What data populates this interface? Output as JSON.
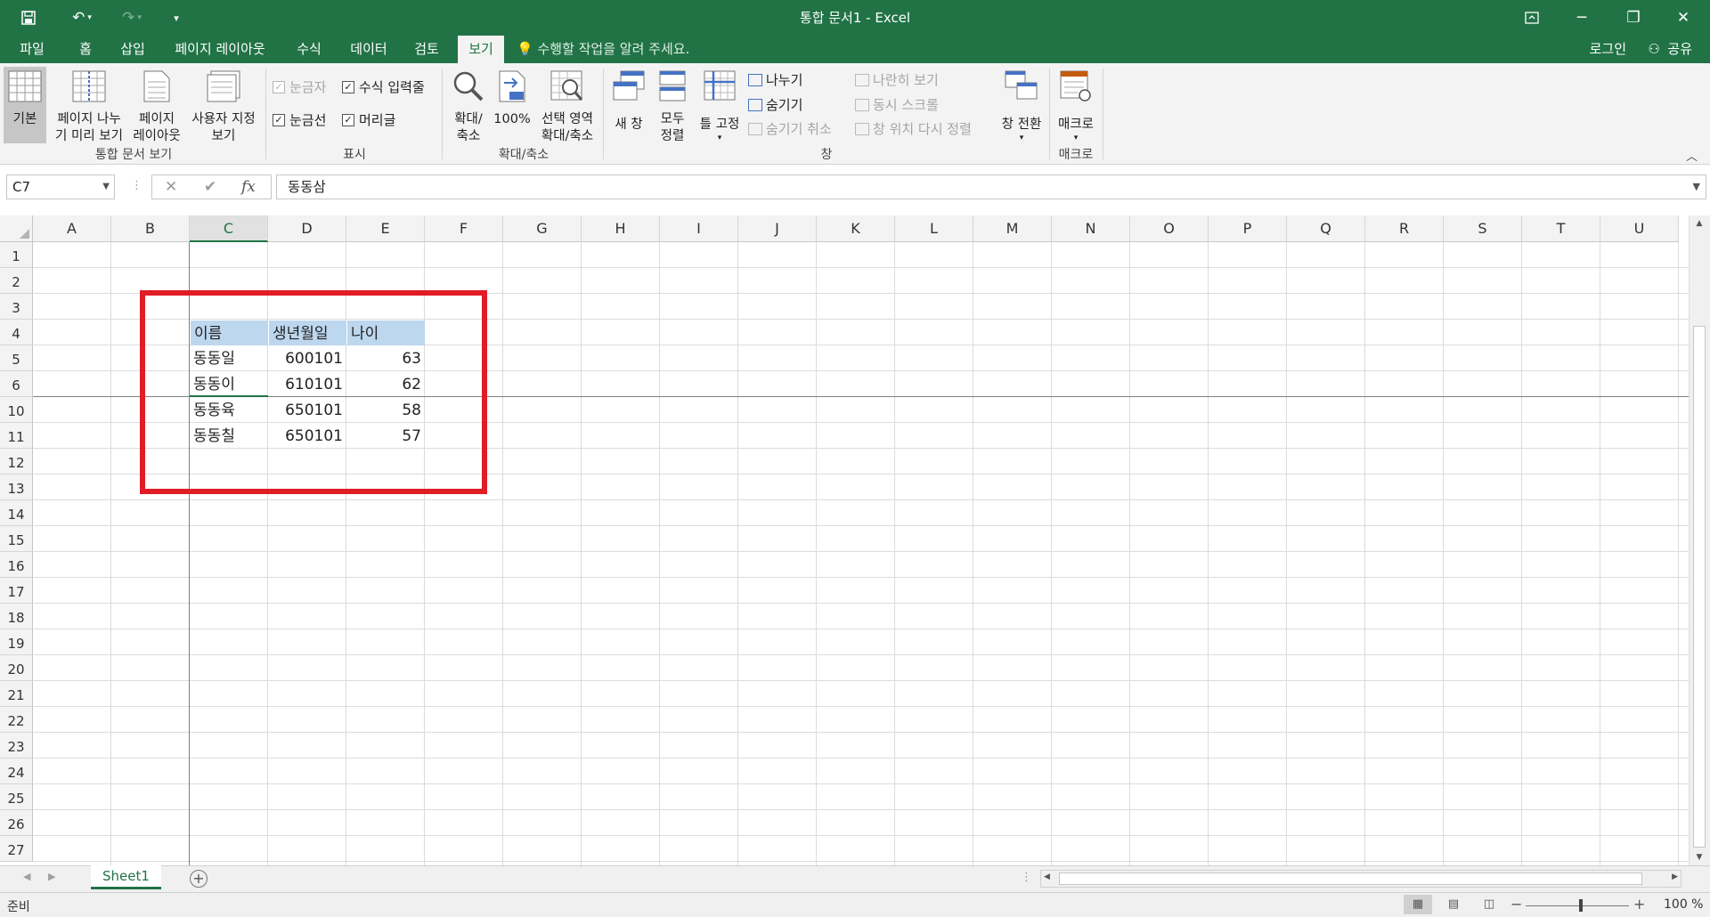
{
  "window": {
    "title": "통합 문서1 - Excel"
  },
  "tabs": [
    "파일",
    "홈",
    "삽입",
    "페이지 레이아웃",
    "수식",
    "데이터",
    "검토",
    "보기"
  ],
  "active_tab": "보기",
  "tell_me": "수행할 작업을 알려 주세요.",
  "account": {
    "login": "로그인",
    "share": "공유"
  },
  "ribbon": {
    "workbook_views": {
      "label": "통합 문서 보기",
      "buttons": [
        {
          "line1": "기본",
          "line2": ""
        },
        {
          "line1": "페이지 나누",
          "line2": "기 미리 보기"
        },
        {
          "line1": "페이지",
          "line2": "레이아웃"
        },
        {
          "line1": "사용자 지정",
          "line2": "보기"
        }
      ]
    },
    "show": {
      "label": "표시",
      "ruler": "눈금자",
      "formula_bar": "수식 입력줄",
      "gridlines": "눈금선",
      "headings": "머리글"
    },
    "zoom": {
      "label": "확대/축소",
      "zoom": {
        "line1": "확대/",
        "line2": "축소"
      },
      "hundred": "100%",
      "zoom_to_selection": {
        "line1": "선택 영역",
        "line2": "확대/축소"
      }
    },
    "window": {
      "label": "창",
      "new_window": "새 창",
      "arrange_all": {
        "line1": "모두",
        "line2": "정렬"
      },
      "freeze_panes": "틀 고정",
      "split": "나누기",
      "hide": "숨기기",
      "unhide": "숨기기 취소",
      "side_by_side": "나란히 보기",
      "sync_scroll": "동시 스크롤",
      "reset_position": "창 위치 다시 정렬",
      "switch_windows": "창 전환"
    },
    "macros": {
      "label": "매크로",
      "button": "매크로"
    }
  },
  "formula_bar": {
    "name_box": "C7",
    "cancel": "✕",
    "enter": "✔",
    "fx": "fx",
    "value": "동동삼"
  },
  "columns": [
    "A",
    "B",
    "C",
    "D",
    "E",
    "F",
    "G",
    "H",
    "I",
    "J",
    "K",
    "L",
    "M",
    "N",
    "O",
    "P",
    "Q",
    "R",
    "S",
    "T",
    "U"
  ],
  "selected_column": "C",
  "rows": [
    "1",
    "2",
    "3",
    "4",
    "5",
    "6",
    "10",
    "11",
    "12",
    "13",
    "14",
    "15",
    "16",
    "17",
    "18",
    "19",
    "20",
    "21",
    "22",
    "23",
    "24",
    "25",
    "26",
    "27"
  ],
  "table": {
    "headers": [
      "이름",
      "생년월일",
      "나이"
    ],
    "rows": [
      [
        "동동일",
        "600101",
        "63"
      ],
      [
        "동동이",
        "610101",
        "62"
      ],
      [
        "동동육",
        "650101",
        "58"
      ],
      [
        "동동칠",
        "650101",
        "57"
      ]
    ]
  },
  "sheets": [
    "Sheet1"
  ],
  "status": {
    "ready": "준비",
    "zoom": "100 %"
  }
}
